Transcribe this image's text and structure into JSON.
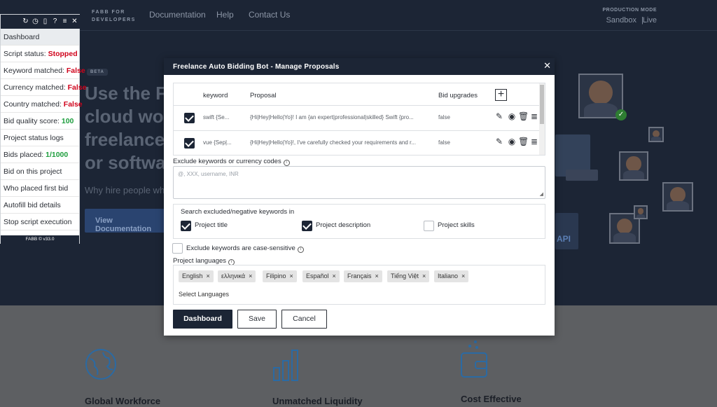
{
  "site": {
    "brand_line1": "FABB FOR",
    "brand_line2": "DEVELOPERS",
    "nav": [
      "Documentation",
      "Help",
      "Contact Us"
    ],
    "mode_label": "PRODUCTION MODE",
    "mode_sandbox": "Sandbox",
    "mode_sep": "|",
    "mode_live": "Live",
    "beta": "BETA",
    "hero_lines": [
      "Use the F",
      "cloud wo",
      "freelance",
      "or softwa"
    ],
    "hero_sub": "Why hire people wh",
    "cta": "View Documentation",
    "badge_api": "API",
    "features": [
      "Global Workforce",
      "Unmatched Liquidity",
      "Cost Effective"
    ]
  },
  "panel": {
    "items": [
      {
        "label": "Dashboard"
      },
      {
        "label": "Script status: ",
        "value": "Stopped"
      },
      {
        "label": "Keyword matched: ",
        "value": "False"
      },
      {
        "label": "Currency matched: ",
        "value": "False"
      },
      {
        "label": "Country matched: ",
        "value": "False"
      },
      {
        "label": "Bid quality score: ",
        "value": "100"
      },
      {
        "label": "Project status logs"
      },
      {
        "label": "Bids placed: ",
        "value": "1/1000"
      },
      {
        "label": "Bid on this project"
      },
      {
        "label": "Who placed first bid"
      },
      {
        "label": "Autofill bid details"
      },
      {
        "label": "Stop script execution"
      }
    ],
    "footer": "FABB © v33.0"
  },
  "modal": {
    "title": "Freelance Auto Bidding Bot - Manage Proposals",
    "close": "✕",
    "table": {
      "headers": [
        "keyword",
        "Proposal",
        "Bid upgrades"
      ],
      "add": "+",
      "rows": [
        {
          "checked": true,
          "keyword": "swift {Se...",
          "proposal": "{Hi|Hey|Hello|Yo}! I am {an expert|professional|skilled} Swift {pro...",
          "upgrades": "false"
        },
        {
          "checked": true,
          "keyword": "vue {Sep|...",
          "proposal": "{Hi|Hey|Hello|Yo}!, I've carefully checked your requirements and r...",
          "upgrades": "false"
        }
      ]
    },
    "exclude_label": "Exclude keywords or currency codes",
    "exclude_placeholder": "@, XXX, username, INR",
    "search_title": "Search excluded/negative keywords in",
    "search_options": [
      {
        "label": "Project title",
        "checked": true
      },
      {
        "label": "Project description",
        "checked": true
      },
      {
        "label": "Project skills",
        "checked": false
      }
    ],
    "case_label": "Exclude keywords are case-sensitive",
    "case_checked": false,
    "languages_label": "Project languages",
    "languages": [
      "English",
      "ελληνικά",
      "Filipino",
      "Español",
      "Français",
      "Tiếng Việt",
      "Italiano"
    ],
    "languages_placeholder": "Select Languages",
    "buttons": {
      "dashboard": "Dashboard",
      "save": "Save",
      "cancel": "Cancel"
    }
  }
}
